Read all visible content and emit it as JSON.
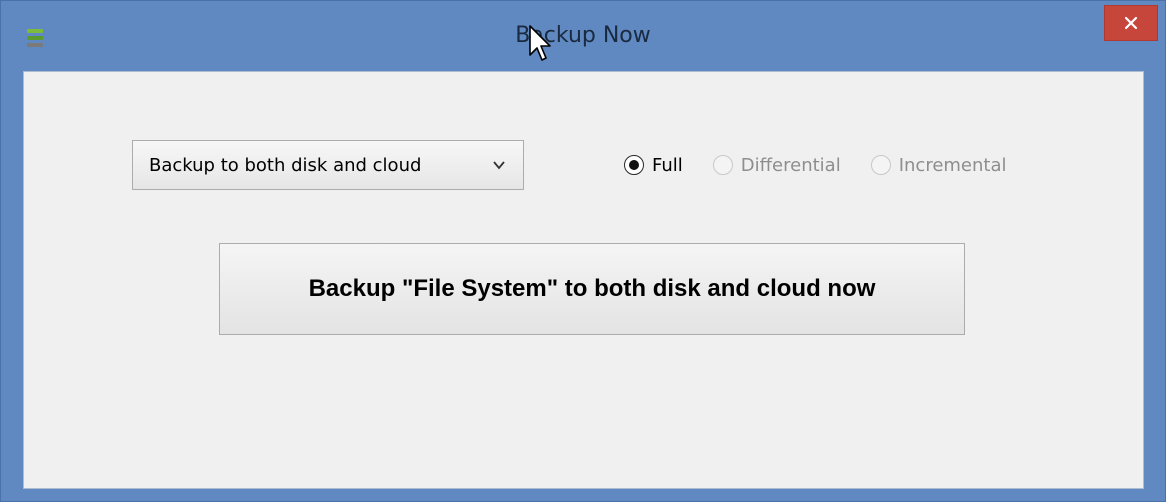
{
  "window": {
    "title": "Backup Now",
    "close_label": "×"
  },
  "backup_target": {
    "selected": "Backup to both disk and cloud"
  },
  "backup_type": {
    "options": [
      {
        "label": "Full",
        "selected": true,
        "enabled": true
      },
      {
        "label": "Differential",
        "selected": false,
        "enabled": false
      },
      {
        "label": "Incremental",
        "selected": false,
        "enabled": false
      }
    ]
  },
  "action": {
    "label": "Backup \"File System\" to both disk and cloud now"
  },
  "colors": {
    "title_bar": "#5f89c0",
    "close_button": "#c7463c",
    "client_background": "#f0f0f0"
  },
  "icons": {
    "app": "app-icon",
    "close": "close-icon",
    "dropdown": "chevron-down-icon",
    "pointer": "mouse-cursor-icon"
  }
}
